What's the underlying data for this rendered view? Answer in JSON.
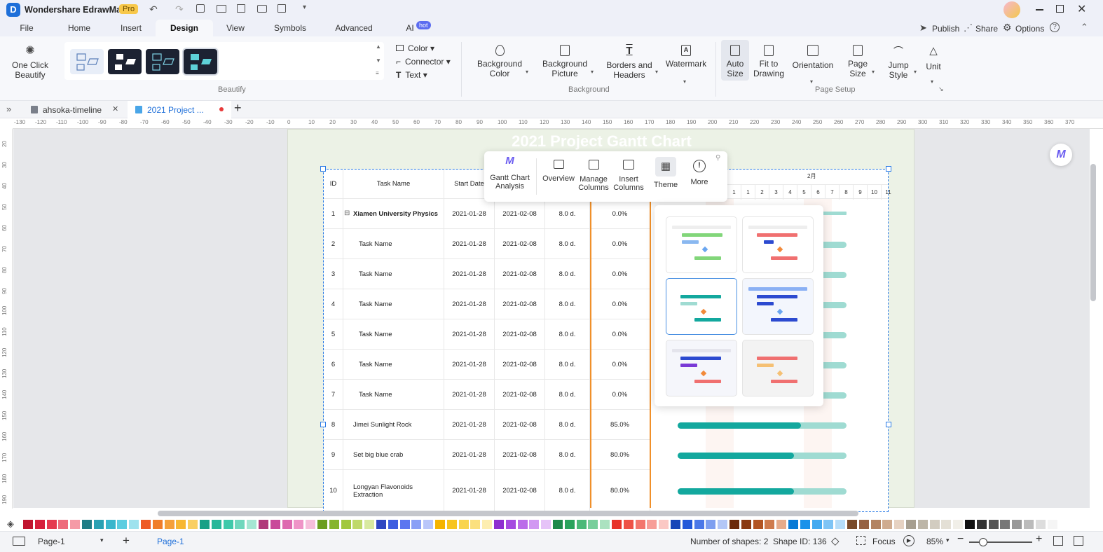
{
  "app": {
    "name": "Wondershare EdrawMax",
    "badge": "Pro"
  },
  "menu": {
    "tabs": [
      "File",
      "Home",
      "Insert",
      "Design",
      "View",
      "Symbols",
      "Advanced",
      "AI"
    ],
    "ai_badge": "hot",
    "active": "Design",
    "right": {
      "publish": "Publish",
      "share": "Share",
      "options": "Options"
    }
  },
  "ribbon": {
    "one_click": "One Click\nBeautify",
    "style_menu": {
      "color": "Color",
      "connector": "Connector",
      "text": "Text"
    },
    "beautify_label": "Beautify",
    "background": {
      "bg_color": "Background\nColor",
      "bg_picture": "Background\nPicture",
      "borders": "Borders and\nHeaders",
      "watermark": "Watermark",
      "label": "Background"
    },
    "page_setup": {
      "auto_size": "Auto\nSize",
      "fit": "Fit to\nDrawing",
      "orientation": "Orientation",
      "page_size": "Page\nSize",
      "jump": "Jump\nStyle",
      "unit": "Unit",
      "label": "Page Setup"
    }
  },
  "doc_tabs": [
    {
      "name": "ahsoka-timeline"
    },
    {
      "name": "2021 Project ..."
    }
  ],
  "ruler": {
    "h": [
      "-130",
      "-120",
      "-110",
      "-100",
      "-90",
      "-80",
      "-70",
      "-60",
      "-50",
      "-40",
      "-30",
      "-20",
      "-10",
      "0",
      "10",
      "20",
      "30",
      "40",
      "50",
      "60",
      "70",
      "80",
      "90",
      "100",
      "110",
      "120",
      "130",
      "140",
      "150",
      "160",
      "170",
      "180",
      "190",
      "200",
      "210",
      "220",
      "230",
      "240",
      "250",
      "260",
      "270",
      "280",
      "290",
      "300",
      "310",
      "320",
      "330",
      "340",
      "350",
      "360",
      "370"
    ],
    "v": [
      "20",
      "30",
      "40",
      "50",
      "60",
      "70",
      "80",
      "90",
      "100",
      "110",
      "120",
      "130",
      "140",
      "150",
      "160",
      "170",
      "180",
      "190"
    ]
  },
  "gantt": {
    "title": "2021 Project Gantt Chart",
    "headers": {
      "id": "ID",
      "name": "Task Name",
      "start": "Start Date"
    },
    "month_label": "2月",
    "day_labels": [
      "1",
      "1",
      "2",
      "3",
      "4",
      "5",
      "6",
      "7",
      "8",
      "9",
      "10",
      "11"
    ],
    "rows": [
      {
        "id": "1",
        "name": "Xiamen University Physics",
        "start": "2021-01-28",
        "end": "2021-02-08",
        "dur": "8.0 d.",
        "pct": "0.0%",
        "progress": 0,
        "bold": true
      },
      {
        "id": "2",
        "name": "Task Name",
        "start": "2021-01-28",
        "end": "2021-02-08",
        "dur": "8.0 d.",
        "pct": "0.0%",
        "progress": 0
      },
      {
        "id": "3",
        "name": "Task Name",
        "start": "2021-01-28",
        "end": "2021-02-08",
        "dur": "8.0 d.",
        "pct": "0.0%",
        "progress": 0
      },
      {
        "id": "4",
        "name": "Task Name",
        "start": "2021-01-28",
        "end": "2021-02-08",
        "dur": "8.0 d.",
        "pct": "0.0%",
        "progress": 0
      },
      {
        "id": "5",
        "name": "Task Name",
        "start": "2021-01-28",
        "end": "2021-02-08",
        "dur": "8.0 d.",
        "pct": "0.0%",
        "progress": 0
      },
      {
        "id": "6",
        "name": "Task Name",
        "start": "2021-01-28",
        "end": "2021-02-08",
        "dur": "8.0 d.",
        "pct": "0.0%",
        "progress": 0
      },
      {
        "id": "7",
        "name": "Task Name",
        "start": "2021-01-28",
        "end": "2021-02-08",
        "dur": "8.0 d.",
        "pct": "0.0%",
        "progress": 0
      },
      {
        "id": "8",
        "name": "Jimei Sunlight Rock",
        "start": "2021-01-28",
        "end": "2021-02-08",
        "dur": "8.0 d.",
        "pct": "85.0%",
        "progress": 0.85
      },
      {
        "id": "9",
        "name": "Set big blue crab",
        "start": "2021-01-28",
        "end": "2021-02-08",
        "dur": "8.0 d.",
        "pct": "80.0%",
        "progress": 0.8
      },
      {
        "id": "10",
        "name": "Longyan Flavonoids\nExtraction",
        "start": "2021-01-28",
        "end": "2021-02-08",
        "dur": "8.0 d.",
        "pct": "80.0%",
        "progress": 0.8
      }
    ]
  },
  "context_toolbar": {
    "analysis": "Gantt Chart\nAnalysis",
    "overview": "Overview",
    "manage": "Manage\nColumns",
    "insert": "Insert\nColumns",
    "theme": "Theme",
    "more": "More"
  },
  "status": {
    "page_selector": "Page-1",
    "page_tab": "Page-1",
    "shapes": "Number of shapes: 2",
    "shape_id": "Shape ID: 136",
    "focus": "Focus",
    "zoom": "85%"
  },
  "colors": {
    "accent": "#1e6fd9",
    "teal": "#13a89e",
    "teal_light": "#9fdbd2",
    "orange_line": "#f0902a"
  },
  "palette": [
    "#c0152f",
    "#d61f3c",
    "#e53950",
    "#ee6b7c",
    "#f59aa6",
    "#1f7d86",
    "#2aa1b3",
    "#3ab6cc",
    "#5ccde0",
    "#9ee2ee",
    "#ee5a24",
    "#f07d2a",
    "#f5a03a",
    "#f7b733",
    "#f9cf62",
    "#19a086",
    "#28b79a",
    "#3fc9aa",
    "#6fd7bd",
    "#a5e6d3",
    "#b03a7a",
    "#c9499a",
    "#de6ab0",
    "#ef94c7",
    "#f6bedb",
    "#6b9e1f",
    "#86b52d",
    "#a1c83e",
    "#bfd96a",
    "#d8e9a0",
    "#2f47c2",
    "#3e5ee0",
    "#5b76f0",
    "#8aa0f6",
    "#b9c6fa",
    "#f5b400",
    "#f7c520",
    "#f9d44d",
    "#fbe07e",
    "#fdeeb0",
    "#8e2fd0",
    "#a54be0",
    "#bb6de9",
    "#d198f2",
    "#e6c3f8",
    "#1f8a4c",
    "#2aa35c",
    "#4bb978",
    "#78ce9b",
    "#abe2c0",
    "#e8332a",
    "#ee5247",
    "#f3766d",
    "#f79e98",
    "#fbc8c4",
    "#1746b8",
    "#2358d9",
    "#4b78e8",
    "#7e9ff0",
    "#b3c7f7",
    "#6b2a0a",
    "#8a3a12",
    "#b25422",
    "#cf7b4d",
    "#e6ab8a",
    "#0a7bd6",
    "#1a92ea",
    "#44aaf0",
    "#7ec4f5",
    "#b6ddf9",
    "#7a4b2a",
    "#966244",
    "#b38462",
    "#cfab8f",
    "#e6d2c2",
    "#a79f90",
    "#bdb6a8",
    "#d2ccc0",
    "#e4e0d6",
    "#f1efe8",
    "#111111",
    "#333333",
    "#555555",
    "#777777",
    "#999999",
    "#bbbbbb",
    "#dddddd",
    "#f5f5f5"
  ]
}
